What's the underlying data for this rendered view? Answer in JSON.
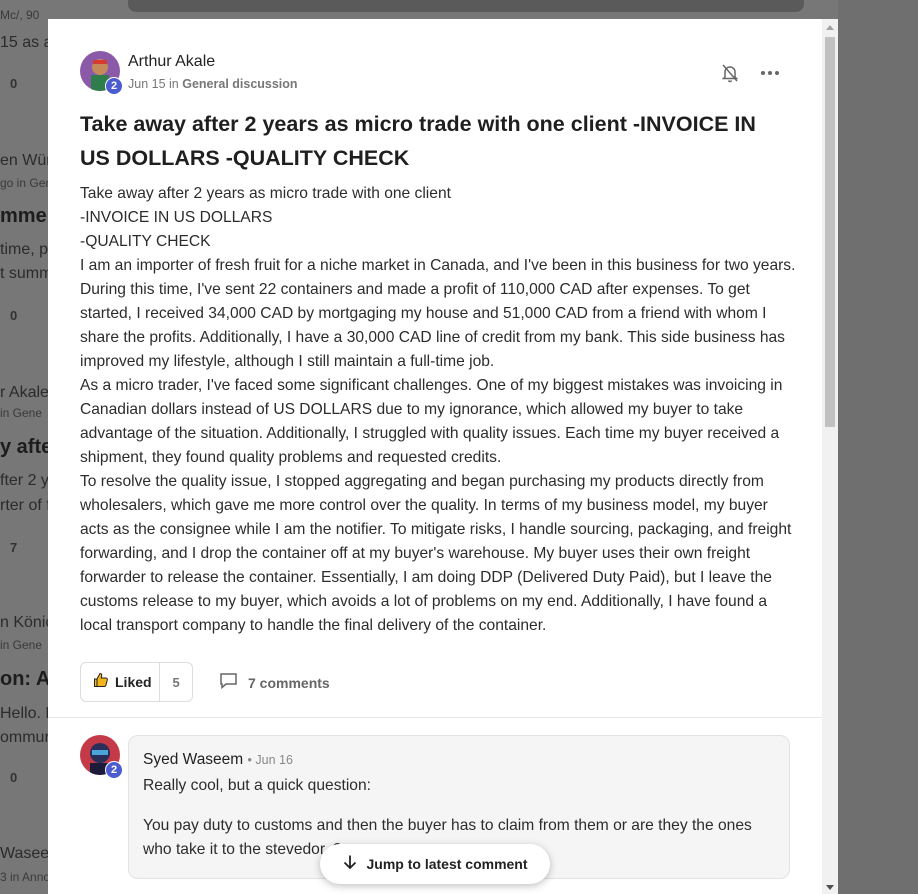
{
  "background": {
    "lines": [
      {
        "text": "Mc/, 90",
        "cls": "small"
      },
      {
        "text": "15 as a",
        "cls": ""
      },
      {
        "text": "0",
        "cls": "count"
      },
      {
        "text": "en Wür",
        "cls": ""
      },
      {
        "text": "go in Gen",
        "cls": "small"
      },
      {
        "text": "mmer",
        "cls": "bold"
      },
      {
        "text": "time, pl",
        "cls": ""
      },
      {
        "text": "t summ",
        "cls": ""
      },
      {
        "text": "0",
        "cls": "count"
      },
      {
        "text": "r Akale",
        "cls": ""
      },
      {
        "text": "in Gene",
        "cls": "small"
      },
      {
        "text": "y afte",
        "cls": "bold"
      },
      {
        "text": "fter 2 y",
        "cls": ""
      },
      {
        "text": "rter of f",
        "cls": ""
      },
      {
        "text": "7",
        "cls": "count"
      },
      {
        "text": "n Könic",
        "cls": ""
      },
      {
        "text": "in Gene",
        "cls": "small"
      },
      {
        "text": "on: A",
        "cls": "bold"
      },
      {
        "text": "Hello. N",
        "cls": ""
      },
      {
        "text": "ommur",
        "cls": ""
      },
      {
        "text": "0",
        "cls": "count"
      },
      {
        "text": "Waseem",
        "cls": ""
      },
      {
        "text": "3 in Anno",
        "cls": "small"
      }
    ]
  },
  "post": {
    "author": "Arthur Akale",
    "badge": "2",
    "date": "Jun 15",
    "in_word": "in",
    "category": "General discussion",
    "title": "Take away after 2 years as micro trade with one client -INVOICE IN US DOLLARS -QUALITY CHECK",
    "body": [
      "Take away after 2 years as micro trade with one client",
      "-INVOICE IN US DOLLARS",
      "-QUALITY CHECK",
      "I am an importer of fresh fruit for a niche market in Canada, and I've been in this business for two years. During this time, I've sent 22 containers and made a profit of 110,000 CAD after expenses. To get started, I received 34,000 CAD by mortgaging my house and 51,000 CAD from a friend with whom I share the profits. Additionally, I have a 30,000 CAD line of credit from my bank. This side business has improved my lifestyle, although I still maintain a full-time job.",
      "As a micro trader, I've faced some significant challenges. One of my biggest mistakes was invoicing in Canadian dollars instead of US DOLLARS due to my ignorance, which allowed my buyer to take advantage of the situation. Additionally, I struggled with quality issues. Each time my buyer received a shipment, they found quality problems and requested credits.",
      "To resolve the quality issue, I stopped aggregating and began purchasing my products directly from wholesalers, which gave me more control over the quality. In terms of my business model, my buyer acts as the consignee while I am the notifier. To mitigate risks, I handle sourcing, packaging, and freight forwarding, and I drop the container off at my buyer's warehouse. My buyer uses their own freight forwarder to release the container. Essentially, I am doing DDP (Delivered Duty Paid), but I leave the customs release to my buyer, which avoids a lot of problems on my end. Additionally, I have found a local transport company to handle the final delivery of the container."
    ],
    "like_label": "Liked",
    "like_count": "5",
    "comments_label": "7 comments"
  },
  "comment": {
    "author": "Syed Waseem",
    "badge": "2",
    "date": "• Jun 16",
    "line1": "Really cool, but a quick question:",
    "line2": "You pay duty to customs and then the buyer has to claim from them or are they the ones who take it to the stevedor..?"
  },
  "jump_label": "Jump to latest comment",
  "colors": {
    "badge": "#4b5bd0",
    "like_thumb": "#f2b51c"
  }
}
